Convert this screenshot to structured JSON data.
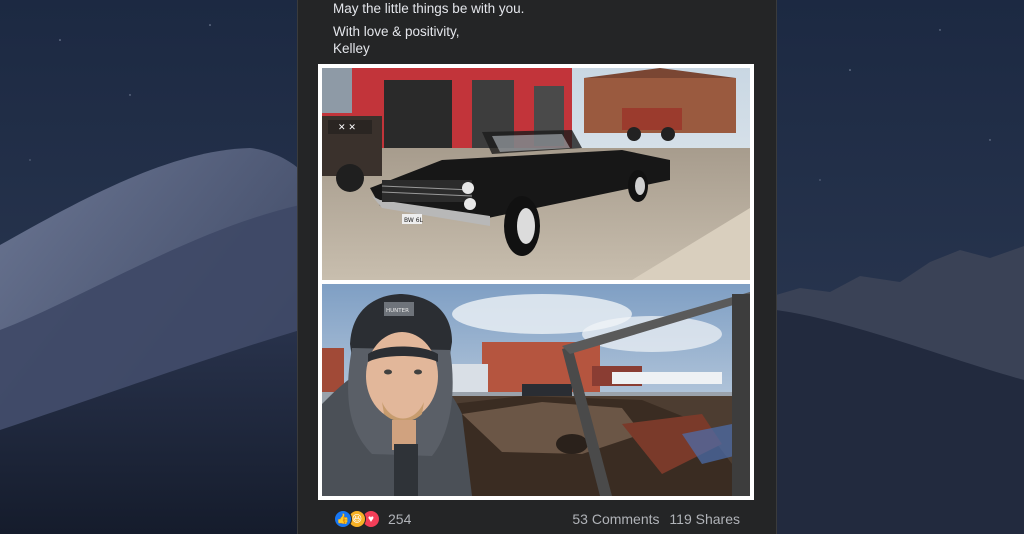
{
  "post": {
    "text_line1": "May the little things be with you.",
    "text_line2": "With love & positivity,",
    "text_line3": "Kelley"
  },
  "photos": {
    "top_plate": "BW 6L",
    "bottom_cap_text": "HUNTER"
  },
  "footer": {
    "reactions": [
      {
        "name": "like-reaction-icon",
        "glyph": "👍"
      },
      {
        "name": "haha-reaction-icon",
        "glyph": "😆"
      },
      {
        "name": "love-reaction-icon",
        "glyph": "♥"
      }
    ],
    "reaction_count": "254",
    "comments": "53 Comments",
    "shares": "119 Shares"
  },
  "colors": {
    "desktop_bg": "#1b2437",
    "card_bg": "#242526",
    "text": "#e4e6eb",
    "muted": "#b0b3b8",
    "like": "#1877f2",
    "love": "#f33e58",
    "haha": "#f7b125"
  }
}
